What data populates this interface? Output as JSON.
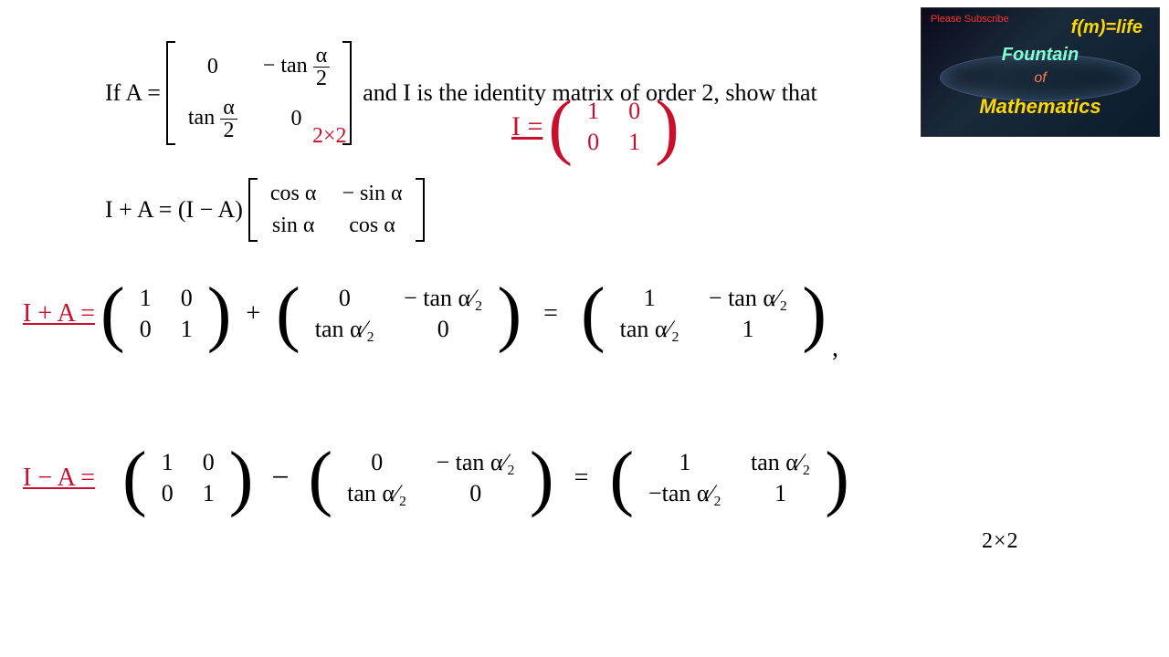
{
  "problem": {
    "prefix": "If  A =",
    "matrixA": {
      "r1c1": "0",
      "r1c2_pre": "− tan",
      "r2c1_pre": "tan",
      "r2c2": "0",
      "frac_num": "α",
      "frac_den": "2"
    },
    "suffix": "and I is the identity matrix of order 2, show that",
    "dim_note": "2×2",
    "identity_label": "I  =",
    "identity": {
      "r1c1": "1",
      "r1c2": "0",
      "r2c1": "0",
      "r2c2": "1"
    },
    "toshow_prefix": "I + A = (I − A)",
    "rotmatrix": {
      "r1c1": "cos α",
      "r1c2": "− sin α",
      "r2c1": "sin α",
      "r2c2": "cos α"
    }
  },
  "work": {
    "line1": {
      "label": "I + A  =",
      "m1": {
        "r1c1": "1",
        "r1c2": "0",
        "r2c1": "0",
        "r2c2": "1"
      },
      "op": "+",
      "m2": {
        "r1c1": "0",
        "r1c2": "− tan α⁄₂",
        "r2c1": "tan α⁄₂",
        "r2c2": "0"
      },
      "eq": "=",
      "m3": {
        "r1c1": "1",
        "r1c2": "− tan α⁄₂",
        "r2c1": "tan α⁄₂",
        "r2c2": "1"
      },
      "trail": ","
    },
    "line2": {
      "label": "I − A  =",
      "m1": {
        "r1c1": "1",
        "r1c2": "0",
        "r2c1": "0",
        "r2c2": "1"
      },
      "op": "−",
      "m2": {
        "r1c1": "0",
        "r1c2": "− tan α⁄₂",
        "r2c1": "tan α⁄₂",
        "r2c2": "0"
      },
      "eq": "=",
      "m3": {
        "r1c1": "1",
        "r1c2": "tan α⁄₂",
        "r2c1": "−tan α⁄₂",
        "r2c2": "1"
      },
      "dim": "2×2"
    }
  },
  "logo": {
    "subscribe": "Please Subscribe",
    "eq": "f(m)=life",
    "l1": "Fountain",
    "l2": "of",
    "l3": "Mathematics"
  }
}
